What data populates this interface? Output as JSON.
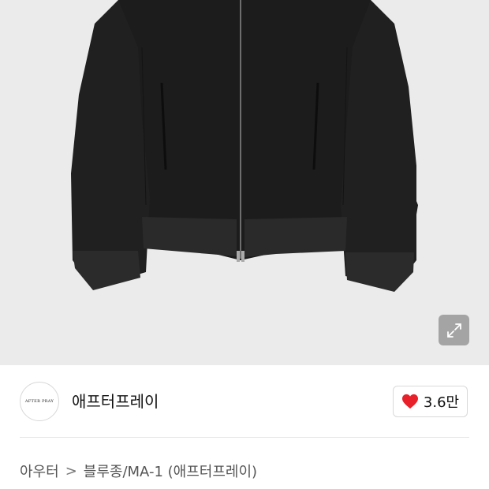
{
  "product_image": {
    "alt": "jacket-image"
  },
  "brand": {
    "logo_text": "AFTER PRAY",
    "name": "애프터프레이"
  },
  "like": {
    "icon": "heart-icon",
    "icon_color": "#e8202a",
    "count": "3.6만"
  },
  "breadcrumb": {
    "category": "아우터",
    "separator": ">",
    "subcategory": "블루종/MA-1 (애프터프레이)"
  },
  "colors": {
    "hero_background": "#ebebeb",
    "heart": "#e8202a"
  }
}
